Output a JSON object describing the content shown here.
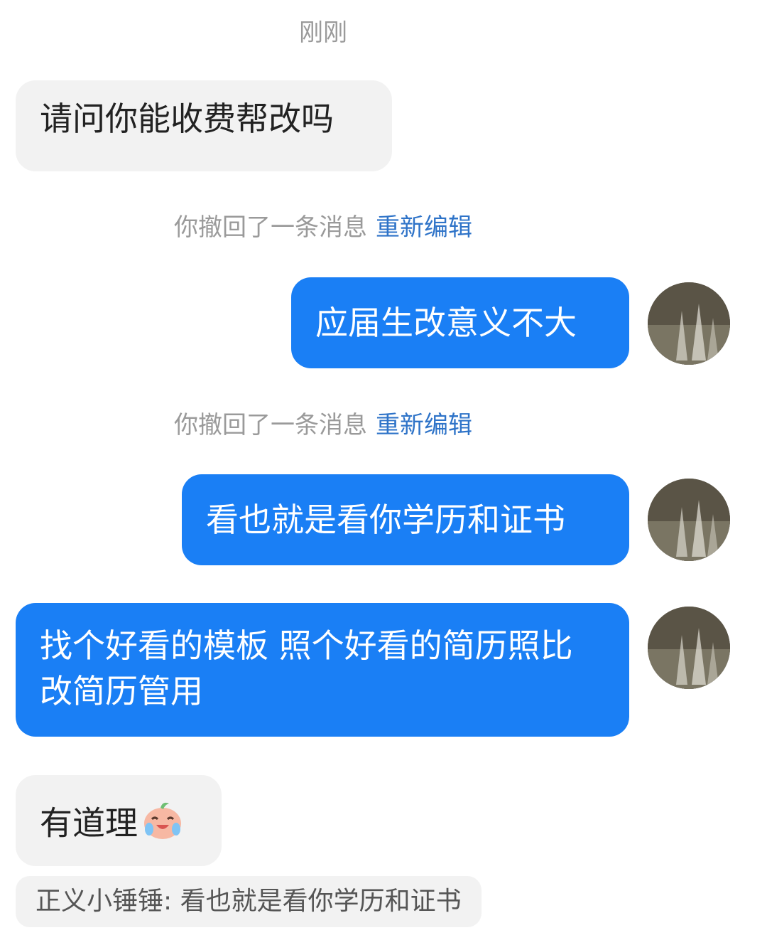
{
  "chat": {
    "timestamp": "刚刚",
    "msg1": "请问你能收费帮改吗",
    "recall_text": "你撤回了一条消息",
    "recall_edit": "重新编辑",
    "msg2": "应届生改意义不大",
    "msg3": "看也就是看你学历和证书",
    "msg4": "找个好看的模板 照个好看的简历照比改简历管用",
    "msg5": "有道理",
    "quote": "正义小锤锤: 看也就是看你学历和证书"
  },
  "colors": {
    "outgoing_bubble": "#1a7ff5",
    "incoming_bubble": "#f2f2f2",
    "link": "#2e73c8"
  },
  "icons": {
    "avatar": "avatar-image",
    "emoji": "laughing-crying-emoji"
  }
}
